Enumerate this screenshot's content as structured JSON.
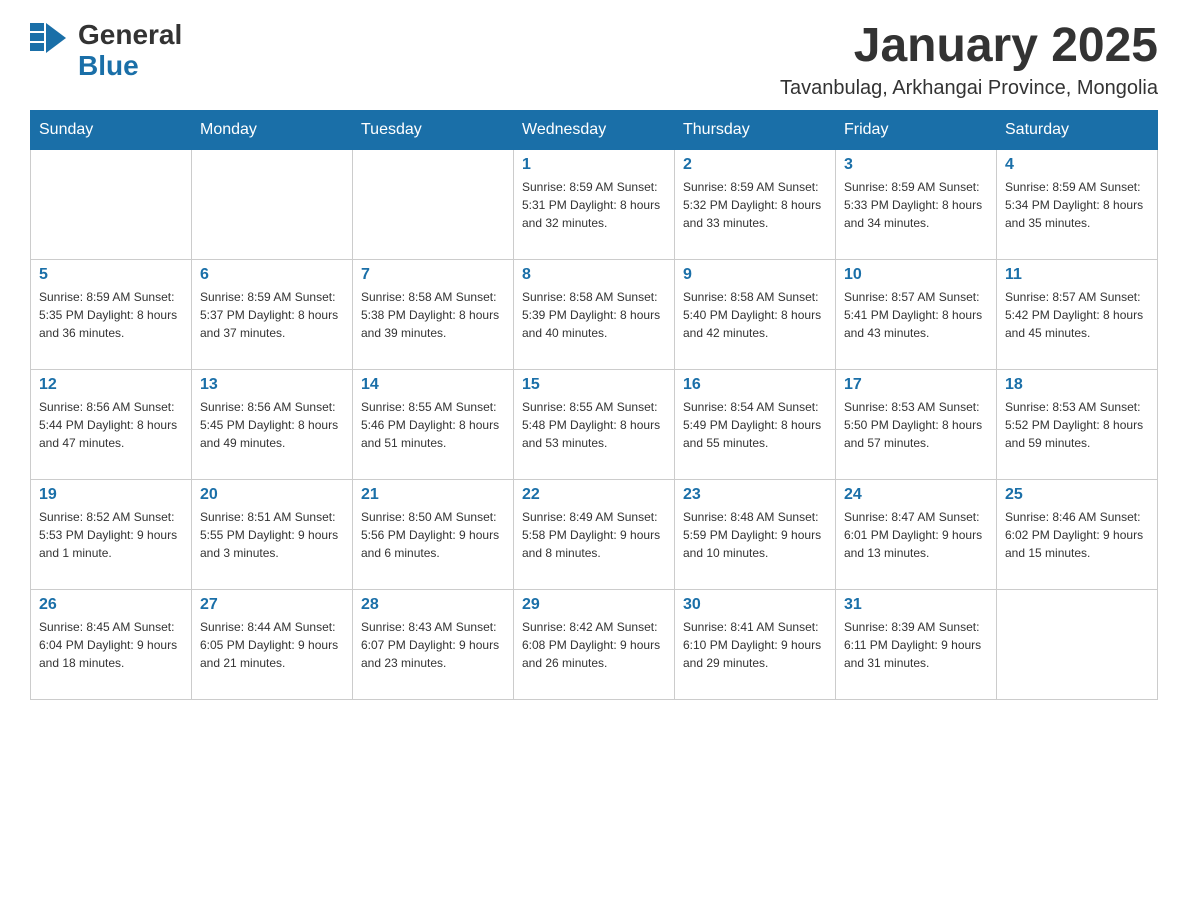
{
  "header": {
    "logo": {
      "general": "General",
      "blue": "Blue",
      "arrow": "▶"
    },
    "month_title": "January 2025",
    "location": "Tavanbulag, Arkhangai Province, Mongolia"
  },
  "days_of_week": [
    "Sunday",
    "Monday",
    "Tuesday",
    "Wednesday",
    "Thursday",
    "Friday",
    "Saturday"
  ],
  "weeks": [
    [
      {
        "day": "",
        "info": ""
      },
      {
        "day": "",
        "info": ""
      },
      {
        "day": "",
        "info": ""
      },
      {
        "day": "1",
        "info": "Sunrise: 8:59 AM\nSunset: 5:31 PM\nDaylight: 8 hours\nand 32 minutes."
      },
      {
        "day": "2",
        "info": "Sunrise: 8:59 AM\nSunset: 5:32 PM\nDaylight: 8 hours\nand 33 minutes."
      },
      {
        "day": "3",
        "info": "Sunrise: 8:59 AM\nSunset: 5:33 PM\nDaylight: 8 hours\nand 34 minutes."
      },
      {
        "day": "4",
        "info": "Sunrise: 8:59 AM\nSunset: 5:34 PM\nDaylight: 8 hours\nand 35 minutes."
      }
    ],
    [
      {
        "day": "5",
        "info": "Sunrise: 8:59 AM\nSunset: 5:35 PM\nDaylight: 8 hours\nand 36 minutes."
      },
      {
        "day": "6",
        "info": "Sunrise: 8:59 AM\nSunset: 5:37 PM\nDaylight: 8 hours\nand 37 minutes."
      },
      {
        "day": "7",
        "info": "Sunrise: 8:58 AM\nSunset: 5:38 PM\nDaylight: 8 hours\nand 39 minutes."
      },
      {
        "day": "8",
        "info": "Sunrise: 8:58 AM\nSunset: 5:39 PM\nDaylight: 8 hours\nand 40 minutes."
      },
      {
        "day": "9",
        "info": "Sunrise: 8:58 AM\nSunset: 5:40 PM\nDaylight: 8 hours\nand 42 minutes."
      },
      {
        "day": "10",
        "info": "Sunrise: 8:57 AM\nSunset: 5:41 PM\nDaylight: 8 hours\nand 43 minutes."
      },
      {
        "day": "11",
        "info": "Sunrise: 8:57 AM\nSunset: 5:42 PM\nDaylight: 8 hours\nand 45 minutes."
      }
    ],
    [
      {
        "day": "12",
        "info": "Sunrise: 8:56 AM\nSunset: 5:44 PM\nDaylight: 8 hours\nand 47 minutes."
      },
      {
        "day": "13",
        "info": "Sunrise: 8:56 AM\nSunset: 5:45 PM\nDaylight: 8 hours\nand 49 minutes."
      },
      {
        "day": "14",
        "info": "Sunrise: 8:55 AM\nSunset: 5:46 PM\nDaylight: 8 hours\nand 51 minutes."
      },
      {
        "day": "15",
        "info": "Sunrise: 8:55 AM\nSunset: 5:48 PM\nDaylight: 8 hours\nand 53 minutes."
      },
      {
        "day": "16",
        "info": "Sunrise: 8:54 AM\nSunset: 5:49 PM\nDaylight: 8 hours\nand 55 minutes."
      },
      {
        "day": "17",
        "info": "Sunrise: 8:53 AM\nSunset: 5:50 PM\nDaylight: 8 hours\nand 57 minutes."
      },
      {
        "day": "18",
        "info": "Sunrise: 8:53 AM\nSunset: 5:52 PM\nDaylight: 8 hours\nand 59 minutes."
      }
    ],
    [
      {
        "day": "19",
        "info": "Sunrise: 8:52 AM\nSunset: 5:53 PM\nDaylight: 9 hours\nand 1 minute."
      },
      {
        "day": "20",
        "info": "Sunrise: 8:51 AM\nSunset: 5:55 PM\nDaylight: 9 hours\nand 3 minutes."
      },
      {
        "day": "21",
        "info": "Sunrise: 8:50 AM\nSunset: 5:56 PM\nDaylight: 9 hours\nand 6 minutes."
      },
      {
        "day": "22",
        "info": "Sunrise: 8:49 AM\nSunset: 5:58 PM\nDaylight: 9 hours\nand 8 minutes."
      },
      {
        "day": "23",
        "info": "Sunrise: 8:48 AM\nSunset: 5:59 PM\nDaylight: 9 hours\nand 10 minutes."
      },
      {
        "day": "24",
        "info": "Sunrise: 8:47 AM\nSunset: 6:01 PM\nDaylight: 9 hours\nand 13 minutes."
      },
      {
        "day": "25",
        "info": "Sunrise: 8:46 AM\nSunset: 6:02 PM\nDaylight: 9 hours\nand 15 minutes."
      }
    ],
    [
      {
        "day": "26",
        "info": "Sunrise: 8:45 AM\nSunset: 6:04 PM\nDaylight: 9 hours\nand 18 minutes."
      },
      {
        "day": "27",
        "info": "Sunrise: 8:44 AM\nSunset: 6:05 PM\nDaylight: 9 hours\nand 21 minutes."
      },
      {
        "day": "28",
        "info": "Sunrise: 8:43 AM\nSunset: 6:07 PM\nDaylight: 9 hours\nand 23 minutes."
      },
      {
        "day": "29",
        "info": "Sunrise: 8:42 AM\nSunset: 6:08 PM\nDaylight: 9 hours\nand 26 minutes."
      },
      {
        "day": "30",
        "info": "Sunrise: 8:41 AM\nSunset: 6:10 PM\nDaylight: 9 hours\nand 29 minutes."
      },
      {
        "day": "31",
        "info": "Sunrise: 8:39 AM\nSunset: 6:11 PM\nDaylight: 9 hours\nand 31 minutes."
      },
      {
        "day": "",
        "info": ""
      }
    ]
  ]
}
